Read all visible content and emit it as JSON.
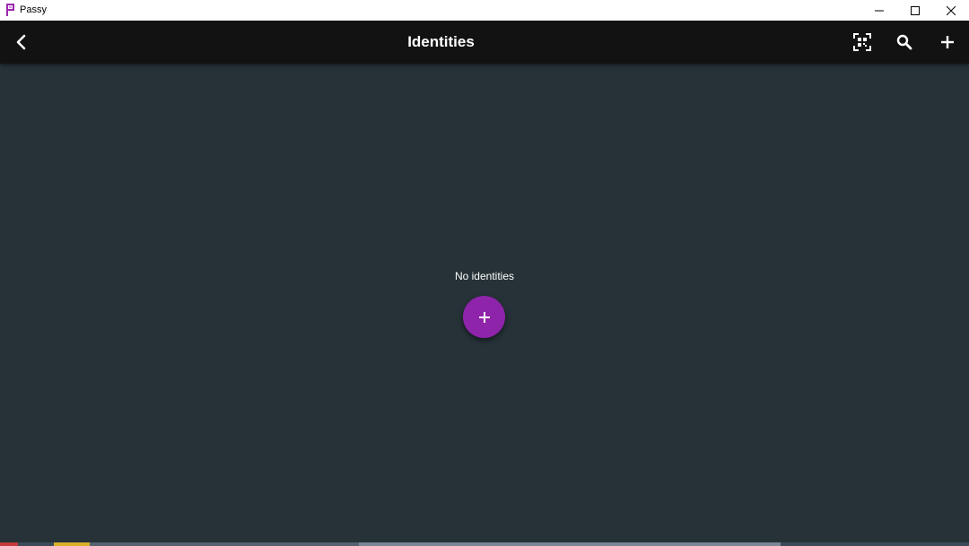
{
  "window": {
    "title": "Passy",
    "app_icon": "passy-logo-icon",
    "controls": [
      "minimize-icon",
      "maximize-icon",
      "close-icon"
    ]
  },
  "appbar": {
    "title": "Identities",
    "back_icon": "chevron-left-icon",
    "actions": [
      "qr-scan-icon",
      "search-icon",
      "plus-icon"
    ]
  },
  "content": {
    "empty_message": "No identities",
    "fab_icon": "plus-icon"
  },
  "colors": {
    "background": "#263238",
    "appbar": "#121212",
    "accent": "#8e24aa",
    "text": "#ffffff"
  }
}
